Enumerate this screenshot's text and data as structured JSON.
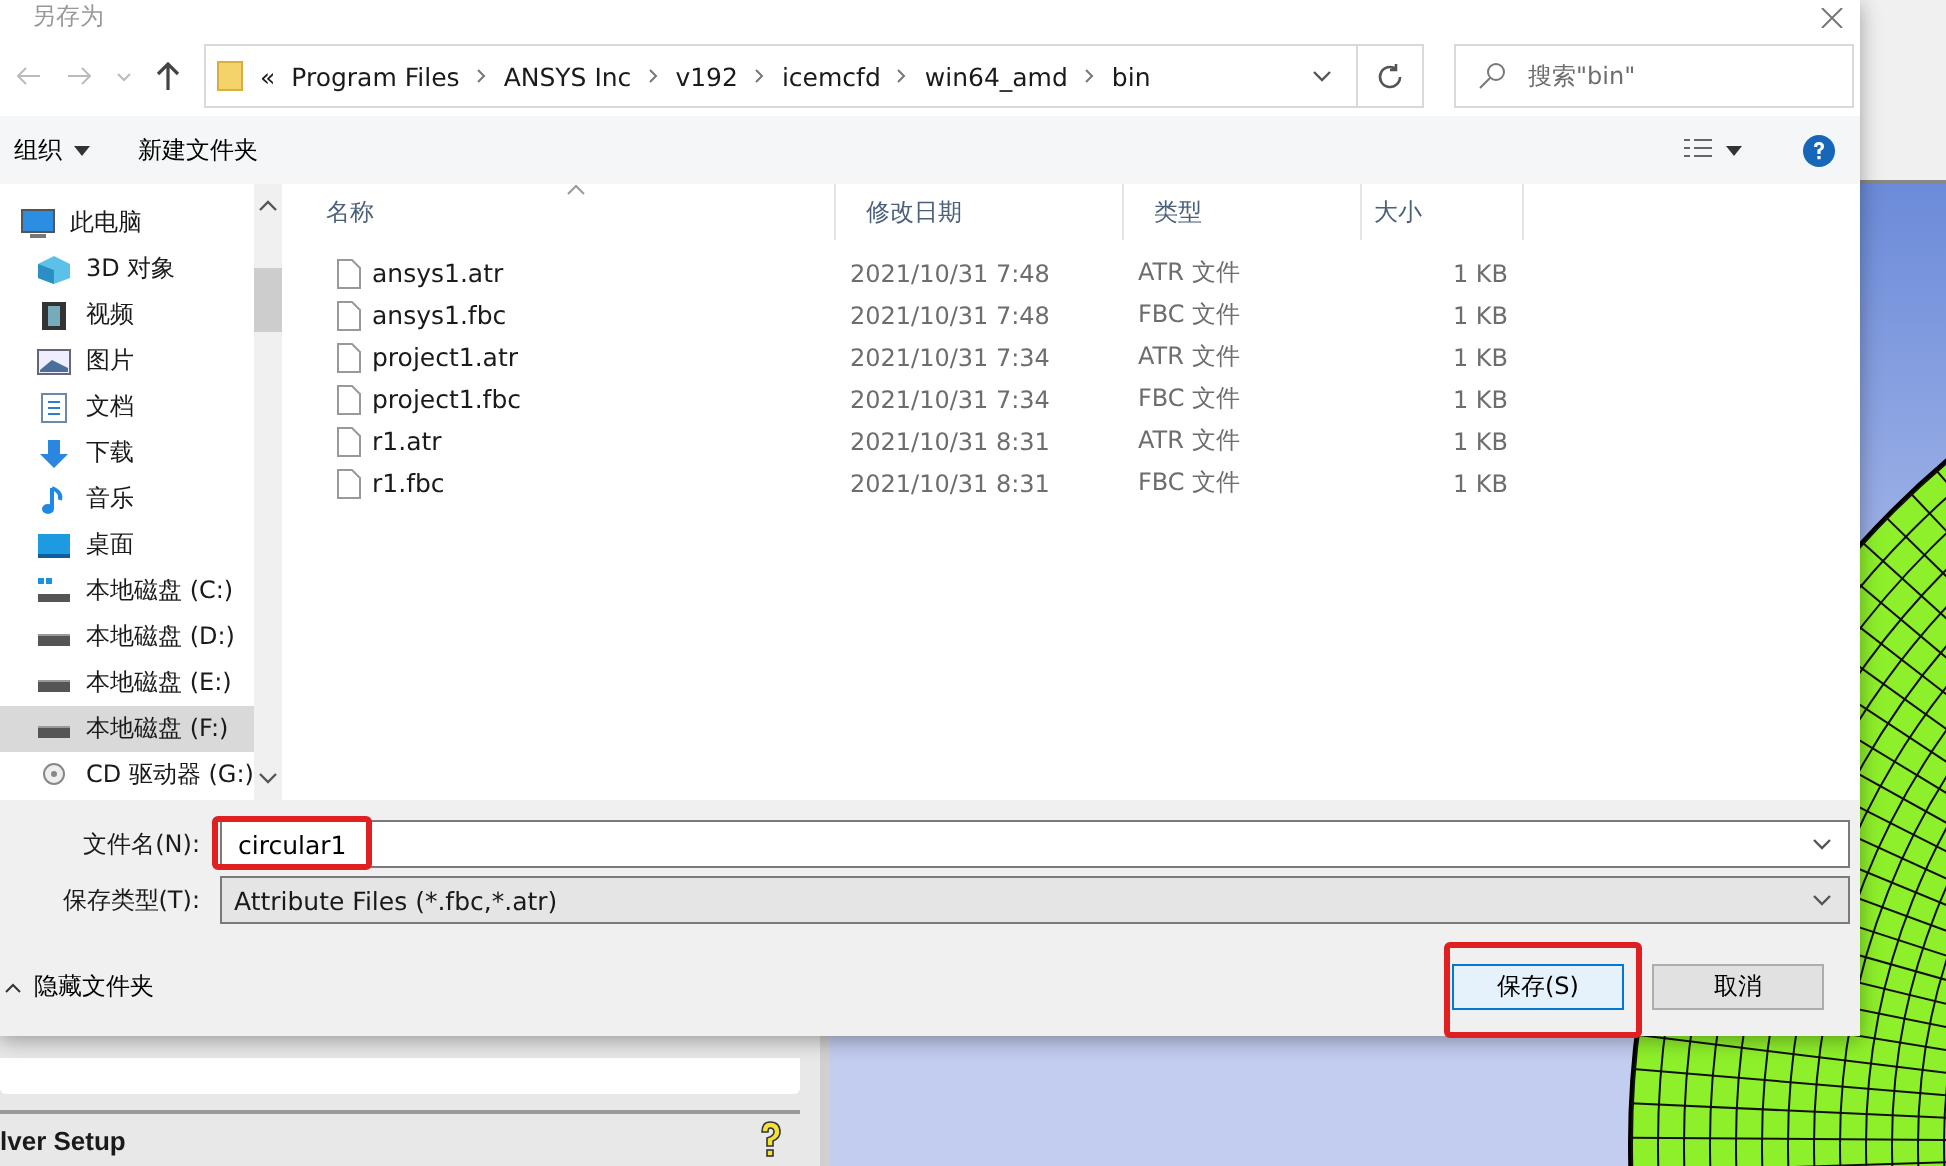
{
  "dialog": {
    "title": "另存为",
    "address": {
      "overflow": "«",
      "crumbs": [
        "Program Files",
        "ANSYS Inc",
        "v192",
        "icemcfd",
        "win64_amd",
        "bin"
      ]
    },
    "search": {
      "placeholder": "搜索\"bin\""
    },
    "toolbar": {
      "organize": "组织",
      "new_folder": "新建文件夹"
    },
    "sidebar": [
      {
        "label": "此电脑",
        "kind": "computer",
        "selected": false,
        "children": [
          {
            "label": "3D 对象",
            "kind": "cube",
            "selected": false
          },
          {
            "label": "视频",
            "kind": "film",
            "selected": false
          },
          {
            "label": "图片",
            "kind": "picture",
            "selected": false
          },
          {
            "label": "文档",
            "kind": "document",
            "selected": false
          },
          {
            "label": "下载",
            "kind": "download",
            "selected": false
          },
          {
            "label": "音乐",
            "kind": "music",
            "selected": false
          },
          {
            "label": "桌面",
            "kind": "desktop",
            "selected": false
          },
          {
            "label": "本地磁盘 (C:)",
            "kind": "system-drive",
            "selected": false
          },
          {
            "label": "本地磁盘 (D:)",
            "kind": "drive",
            "selected": false
          },
          {
            "label": "本地磁盘 (E:)",
            "kind": "drive",
            "selected": false
          },
          {
            "label": "本地磁盘 (F:)",
            "kind": "drive",
            "selected": true
          },
          {
            "label": "CD 驱动器 (G:)",
            "kind": "disc",
            "selected": false
          }
        ]
      }
    ],
    "table": {
      "columns": [
        {
          "label": "名称",
          "sorted": true
        },
        {
          "label": "修改日期",
          "sorted": false
        },
        {
          "label": "类型",
          "sorted": false
        },
        {
          "label": "大小",
          "sorted": false
        }
      ],
      "rows": [
        {
          "name": "ansys1.atr",
          "date": "2021/10/31 7:48",
          "type": "ATR 文件",
          "size": "1 KB",
          "selected": false
        },
        {
          "name": "ansys1.fbc",
          "date": "2021/10/31 7:48",
          "type": "FBC 文件",
          "size": "1 KB",
          "selected": false
        },
        {
          "name": "project1.atr",
          "date": "2021/10/31 7:34",
          "type": "ATR 文件",
          "size": "1 KB",
          "selected": false
        },
        {
          "name": "project1.fbc",
          "date": "2021/10/31 7:34",
          "type": "FBC 文件",
          "size": "1 KB",
          "selected": false
        },
        {
          "name": "r1.atr",
          "date": "2021/10/31 8:31",
          "type": "ATR 文件",
          "size": "1 KB",
          "selected": false
        },
        {
          "name": "r1.fbc",
          "date": "2021/10/31 8:31",
          "type": "FBC 文件",
          "size": "1 KB",
          "selected": false
        }
      ]
    },
    "filename": {
      "label": "文件名(N):",
      "value": "circular1"
    },
    "filetype": {
      "label": "保存类型(T):",
      "value": "Attribute Files (*.fbc,*.atr)"
    },
    "hide_folders": "隐藏文件夹",
    "buttons": [
      {
        "label": "保存(S)",
        "default": true
      },
      {
        "label": "取消",
        "default": false
      }
    ]
  },
  "app": {
    "panel_title": "lver Setup"
  }
}
